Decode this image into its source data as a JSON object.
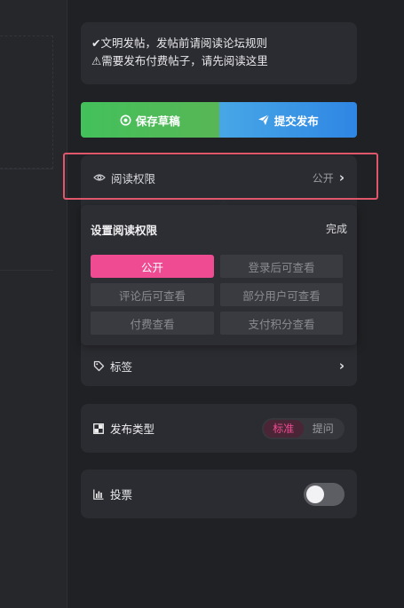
{
  "notice": {
    "line1": "✔文明发帖，发帖前请阅读论坛规则",
    "line2": "⚠需要发布付费帖子，请先阅读这里"
  },
  "actions": {
    "save_label": "保存草稿",
    "publish_label": "提交发布"
  },
  "permission": {
    "label": "阅读权限",
    "value": "公开",
    "panel_title": "设置阅读权限",
    "done_label": "完成",
    "options": [
      "公开",
      "登录后可查看",
      "评论后可查看",
      "部分用户可查看",
      "付费查看",
      "支付积分查看"
    ],
    "selected": "公开"
  },
  "tags": {
    "label": "标签"
  },
  "post_type": {
    "label": "发布类型",
    "options": [
      "标准",
      "提问"
    ],
    "selected": "标准"
  },
  "vote": {
    "label": "投票",
    "enabled": false
  },
  "colors": {
    "accent_pink": "#ef4b92",
    "save_green": "#4cbb58",
    "publish_blue": "#3b93e5",
    "highlight_red": "#e0566b"
  },
  "icons": {
    "save": "check-circle-icon",
    "publish": "paper-plane-icon",
    "permission": "eye-icon",
    "tags": "tag-icon",
    "post_type": "type-squares-icon",
    "vote": "bar-chart-icon"
  }
}
